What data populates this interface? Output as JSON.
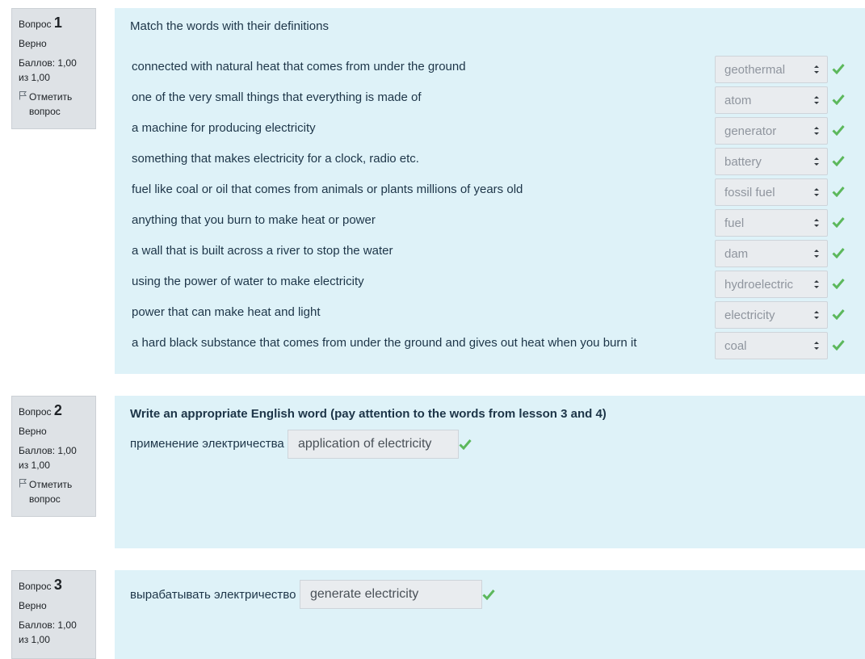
{
  "q1": {
    "info": {
      "label": "Вопрос",
      "number": "1",
      "state": "Верно",
      "grade": "Баллов: 1,00 из 1,00",
      "flag_label": "Отметить вопрос"
    },
    "question_text": "Match the words with their definitions",
    "rows": [
      {
        "definition": "connected with natural heat that comes from under the ground",
        "answer": "geothermal",
        "correct": true
      },
      {
        "definition": "one of the very small things that everything is made of",
        "answer": "atom",
        "correct": true
      },
      {
        "definition": "a machine for producing electricity",
        "answer": "generator",
        "correct": true
      },
      {
        "definition": "something that makes electricity for a clock, radio etc.",
        "answer": "battery",
        "correct": true
      },
      {
        "definition": "fuel like coal or oil that comes from animals or plants millions of years old",
        "answer": "fossil fuel",
        "correct": true
      },
      {
        "definition": "anything that you burn to make heat or power",
        "answer": "fuel",
        "correct": true
      },
      {
        "definition": "a wall that is built across a river to stop the water",
        "answer": "dam",
        "correct": true
      },
      {
        "definition": "using the power of water to make electricity",
        "answer": "hydroelectric",
        "correct": true
      },
      {
        "definition": "power that can make heat and light",
        "answer": "electricity",
        "correct": true
      },
      {
        "definition": "a hard black substance that comes from under the ground and gives out heat when you burn it",
        "answer": "coal",
        "correct": true
      }
    ]
  },
  "q2": {
    "info": {
      "label": "Вопрос",
      "number": "2",
      "state": "Верно",
      "grade": "Баллов: 1,00 из 1,00",
      "flag_label": "Отметить вопрос"
    },
    "question_text": "Write an appropriate English word (pay attention to the words from lesson 3 and 4)",
    "prompt": "применение электричества",
    "answer": "application of electricity"
  },
  "q3": {
    "info": {
      "label": "Вопрос",
      "number": "3",
      "state": "Верно",
      "grade": "Баллов: 1,00 из 1,00"
    },
    "prompt": "вырабатывать электричество",
    "answer": "generate electricity"
  },
  "colors": {
    "correct_check": "#5cb85c",
    "content_bg": "#def2f8",
    "info_bg": "#dee2e6"
  },
  "icons": {
    "flag": "flag-icon",
    "check": "check-icon",
    "select_arrows": "select-arrows-icon"
  }
}
